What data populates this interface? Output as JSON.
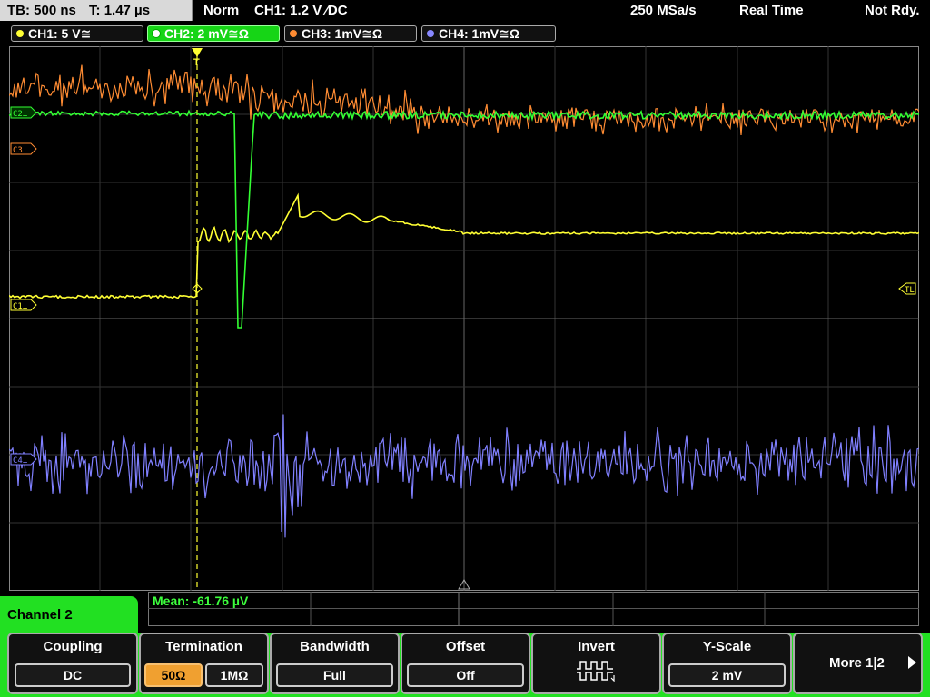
{
  "status": {
    "timebase": "TB: 500 ns",
    "trigger_time": "T: 1.47 µs",
    "mode": "Norm",
    "trigger_setting": "CH1: 1.2 V ∕DC",
    "sample_rate": "250 MSa/s",
    "acq_mode": "Real Time",
    "ready_state": "Not Rdy."
  },
  "channel_tabs": [
    {
      "label": "CH1: 5 V≅",
      "color": "#ffff33"
    },
    {
      "label": "CH2: 2 mV≅Ω",
      "color": "#33ff33",
      "selected": true
    },
    {
      "label": "CH3: 1mV≅Ω",
      "color": "#ff8c33"
    },
    {
      "label": "CH4: 1mV≅Ω",
      "color": "#8888ff"
    }
  ],
  "markers": {
    "c3": "C3⊥",
    "c1": "C1⊥",
    "c2": "C2⊥",
    "c4": "C4⊥",
    "trigger_level": "TL",
    "trigger_pos": "T"
  },
  "measurement": {
    "label": "Mean: -61.76 µV"
  },
  "menu": {
    "title": "Channel 2",
    "softkeys": {
      "coupling": {
        "title": "Coupling",
        "value": "DC"
      },
      "termination": {
        "title": "Termination",
        "options": [
          "50Ω",
          "1MΩ"
        ],
        "active": "50Ω"
      },
      "bandwidth": {
        "title": "Bandwidth",
        "value": "Full"
      },
      "offset": {
        "title": "Offset",
        "value": "Off"
      },
      "invert": {
        "title": "Invert"
      },
      "yscale": {
        "title": "Y-Scale",
        "value": "2 mV"
      },
      "more": {
        "label": "More 1|2"
      }
    }
  },
  "colors": {
    "ch1": "#ffff33",
    "ch2": "#33ff33",
    "ch3": "#ff8c33",
    "ch4": "#8080ff",
    "accent_green": "#22e022",
    "active_orange": "#f0a030"
  }
}
